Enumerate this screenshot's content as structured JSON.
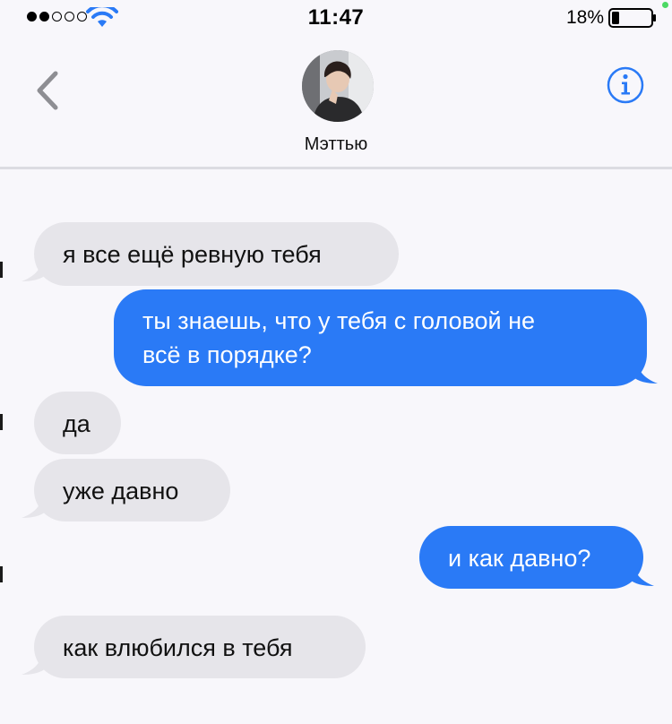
{
  "status_bar": {
    "signal_filled": 2,
    "signal_total": 5,
    "time": "11:47",
    "battery_percent": "18%",
    "battery_level": 0.18
  },
  "header": {
    "contact_name": "Мэттью",
    "back_icon": "chevron-left-icon",
    "info_icon": "info-icon"
  },
  "colors": {
    "incoming_bubble": "#e6e5ea",
    "outgoing_bubble": "#2a7af6",
    "accent": "#2a7af6",
    "background": "#f8f7fb"
  },
  "messages": [
    {
      "direction": "incoming",
      "text": "я все ещё ревную тебя"
    },
    {
      "direction": "outgoing",
      "line1": "ты знаешь, что у тебя с головой не",
      "line2": "всё в порядке?"
    },
    {
      "direction": "incoming",
      "text": "да"
    },
    {
      "direction": "incoming",
      "text": "уже давно"
    },
    {
      "direction": "outgoing",
      "text": "и как давно?"
    },
    {
      "direction": "incoming",
      "text": "как влюбился в тебя"
    }
  ]
}
